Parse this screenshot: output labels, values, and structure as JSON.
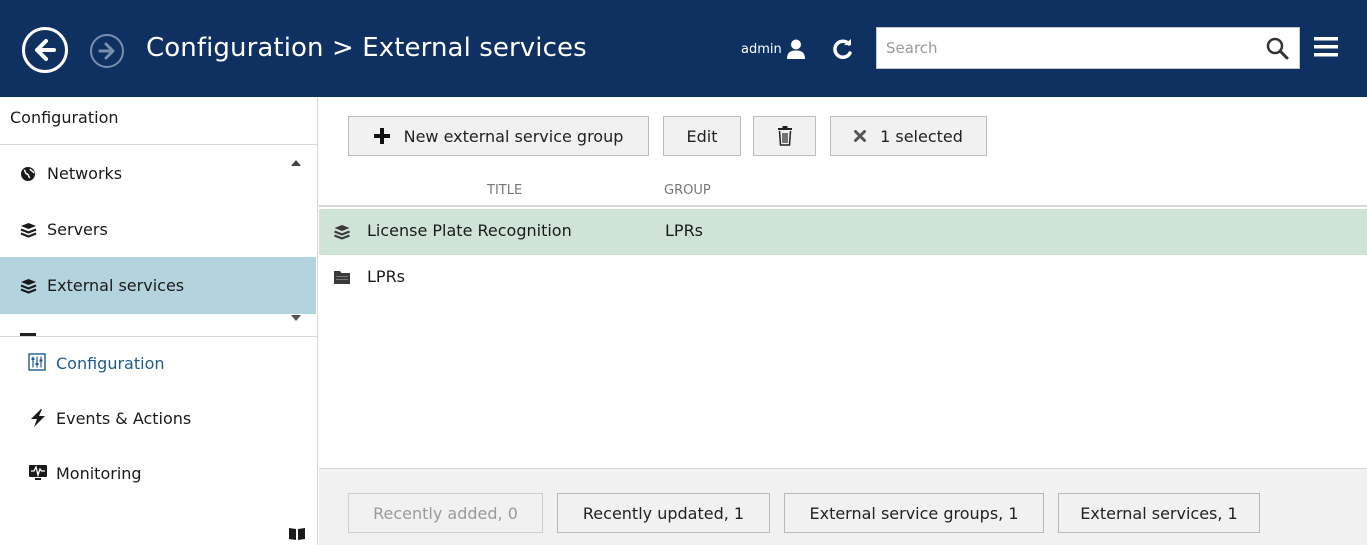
{
  "header": {
    "title": "Configuration > External services",
    "username": "admin",
    "search_placeholder": "Search",
    "search_value": "",
    "colors": {
      "background": "#0e3161",
      "text": "#ffffff"
    }
  },
  "sidebar": {
    "heading": "Configuration",
    "items": [
      {
        "label": "Networks",
        "icon": "globe-icon"
      },
      {
        "label": "Servers",
        "icon": "layers-icon"
      },
      {
        "label": "External services",
        "icon": "layers-icon",
        "active": true
      }
    ],
    "bottom_nav": [
      {
        "label": "Configuration",
        "icon": "sliders-icon",
        "current": true
      },
      {
        "label": "Events & Actions",
        "icon": "lightning-icon"
      },
      {
        "label": "Monitoring",
        "icon": "pulse-monitor-icon"
      }
    ],
    "active_color": "#b4d4dd"
  },
  "toolbar": {
    "new_label": "New external service group",
    "edit_label": "Edit",
    "selected_label": "1 selected"
  },
  "table": {
    "columns": [
      "TITLE",
      "GROUP"
    ],
    "rows": [
      {
        "title": "License Plate Recognition",
        "group": "LPRs",
        "icon": "layers-icon",
        "selected": true
      },
      {
        "title": "LPRs",
        "group": "",
        "icon": "folder-icon",
        "selected": false
      }
    ],
    "selected_color": "#cfe4d6"
  },
  "footer": {
    "recently_added": "Recently added, 0",
    "recently_updated": "Recently updated, 1",
    "external_service_groups": "External service groups, 1",
    "external_services": "External services, 1"
  }
}
